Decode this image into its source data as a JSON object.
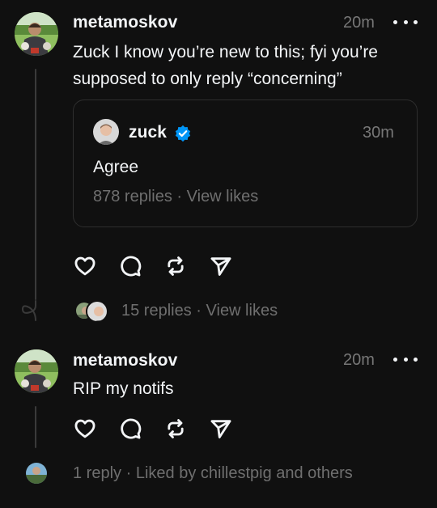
{
  "post1": {
    "username": "metamoskov",
    "time": "20m",
    "text_line1": "Zuck I know you’re new to this; fyi you’re",
    "text_line2": "supposed to only reply “concerning”",
    "quote": {
      "username": "zuck",
      "time": "30m",
      "text": "Agree",
      "replies": "878 replies",
      "sep": "·",
      "view_likes": "View likes"
    },
    "replies": "15 replies",
    "sep": "·",
    "view_likes": "View likes"
  },
  "post2": {
    "username": "metamoskov",
    "time": "20m",
    "text": "RIP my notifs",
    "replies": "1 reply",
    "sep": "·",
    "liked_by": "Liked by chillestpig and others"
  },
  "icons": [
    "heart-icon",
    "comment-icon",
    "repost-icon",
    "share-icon",
    "more-icon",
    "verified-badge-icon"
  ],
  "colors": {
    "background": "#101010",
    "text": "#f3f5f7",
    "muted": "#777777",
    "verified": "#0095f6",
    "border": "#2e2e2e"
  }
}
